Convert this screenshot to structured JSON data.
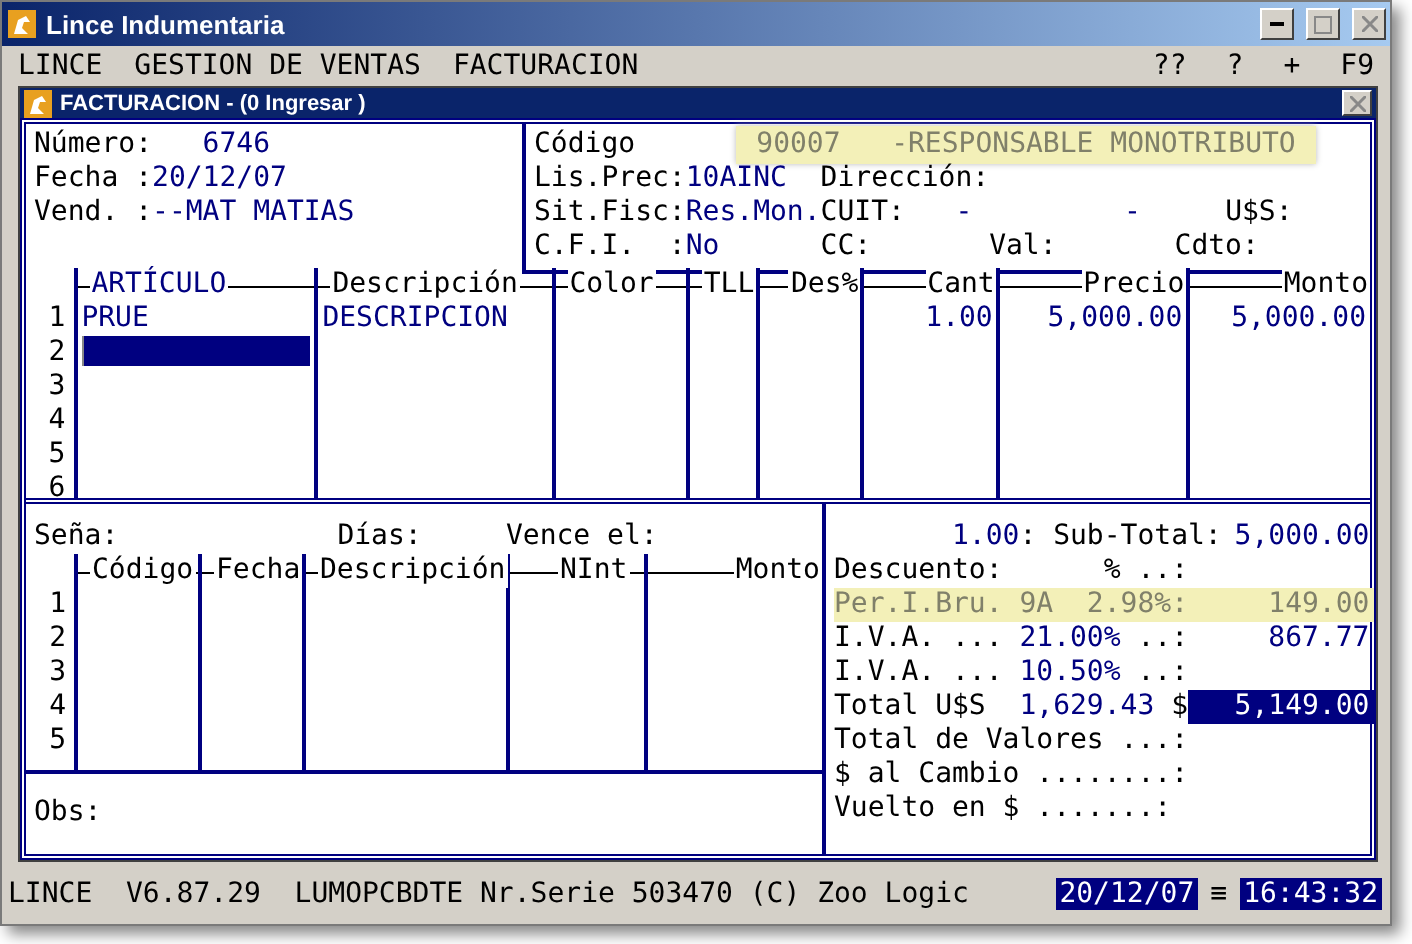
{
  "window": {
    "title": "Lince Indumentaria"
  },
  "menu": {
    "items": [
      "LINCE",
      "GESTION DE VENTAS",
      "FACTURACION"
    ],
    "shortcuts": [
      "??",
      "?",
      "+",
      "F9"
    ]
  },
  "form": {
    "title": "FACTURACION - (0 Ingresar )",
    "header_left": [
      {
        "label": "Número:",
        "value": "6746",
        "kind": "spaced"
      },
      {
        "label": "Fecha :",
        "value": "20/12/07",
        "kind": "plain"
      },
      {
        "label": "Vend. :",
        "value": "--MAT MATIAS",
        "kind": "plain"
      }
    ],
    "codigo": {
      "label": "Código",
      "value": "90007   -RESPONSABLE MONOTRIBUTO"
    },
    "header_right": [
      [
        {
          "label": "Lis.Prec:",
          "value": "10AINC"
        },
        {
          "label": "Dirección:"
        }
      ],
      [
        {
          "label": "Sit.Fisc:",
          "value": "Res.Mon."
        },
        {
          "label": "CUIT:",
          "value": "   -         -"
        },
        {
          "label": "U$S:"
        }
      ],
      [
        {
          "label": "C.F.I.  :",
          "value": "No"
        },
        {
          "label": "CC:"
        },
        {
          "label": "Val:"
        },
        {
          "label": "Cdto:"
        }
      ]
    ]
  },
  "items": {
    "columns": [
      {
        "label": "ARTÍCULO",
        "selected": true
      },
      {
        "label": "Descripción",
        "selected": false
      },
      {
        "label": "Color",
        "selected": false
      },
      {
        "label": "TLL",
        "selected": false
      },
      {
        "label": "Des%",
        "selected": false
      },
      {
        "label": "Cant",
        "selected": false
      },
      {
        "label": "Precio",
        "selected": false
      },
      {
        "label": "Monto",
        "selected": false
      }
    ],
    "rows": [
      {
        "number": "1",
        "articulo": "PRUE",
        "descripcion": "DESCRIPCION",
        "cant": "1.00",
        "precio": "5,000.00",
        "monto": "5,000.00",
        "editing": false
      },
      {
        "number": "2",
        "editing": true
      },
      {
        "number": "3",
        "editing": false
      },
      {
        "number": "4",
        "editing": false
      },
      {
        "number": "5",
        "editing": false
      },
      {
        "number": "6",
        "editing": false
      }
    ]
  },
  "deposit": [
    "Seña:",
    "Días:",
    "Vence el:"
  ],
  "payments": {
    "columns": [
      "Código",
      "Fecha",
      "Descripción",
      "NInt",
      "Monto"
    ],
    "rows": [
      "1",
      "2",
      "3",
      "4",
      "5"
    ]
  },
  "obs": "Obs:",
  "totals": [
    {
      "kind": "indented",
      "segments": [
        {
          "text": "1.00",
          "kind": "value"
        },
        {
          "text": ": Sub-Total:",
          "kind": "label"
        }
      ],
      "amount": "5,000.00"
    },
    {
      "kind": "plain",
      "segments": [
        {
          "text": "Descuento:      % ..:",
          "kind": "label"
        }
      ]
    },
    {
      "kind": "plain",
      "segments": [
        {
          "text": "Per.I.Bru. 9A  2.98%:",
          "kind": "label"
        }
      ],
      "amount": "149.00",
      "highlighted": true
    },
    {
      "kind": "plain",
      "segments": [
        {
          "text": "I.V.A. ... ",
          "kind": "label"
        },
        {
          "text": "21.00%",
          "kind": "value"
        },
        {
          "text": " ..:",
          "kind": "label"
        }
      ],
      "amount": "867.77"
    },
    {
      "kind": "plain",
      "segments": [
        {
          "text": "I.V.A. ... ",
          "kind": "label"
        },
        {
          "text": "10.50%",
          "kind": "value"
        },
        {
          "text": " ..:",
          "kind": "label"
        }
      ]
    },
    {
      "kind": "plain",
      "segments": [
        {
          "text": "Total U$S  ",
          "kind": "label"
        },
        {
          "text": "1,629.43",
          "kind": "value"
        },
        {
          "text": " $",
          "kind": "label"
        }
      ],
      "amount": "5,149.00",
      "boxed": true
    },
    {
      "kind": "plain",
      "segments": [
        {
          "text": "Total de Valores ...:",
          "kind": "label"
        }
      ]
    },
    {
      "kind": "plain",
      "segments": [
        {
          "text": "$ al Cambio ........:",
          "kind": "label"
        }
      ]
    },
    {
      "kind": "plain",
      "segments": [
        {
          "text": "Vuelto en $ .......:",
          "kind": "label"
        }
      ]
    }
  ],
  "status_bar": {
    "text": "LINCE  V6.87.29  LUMOPCBDTE Nr.Serie 503470 (C) Zoo Logic",
    "date": "20/12/07",
    "separator": "≡",
    "time": "16:43:32"
  }
}
